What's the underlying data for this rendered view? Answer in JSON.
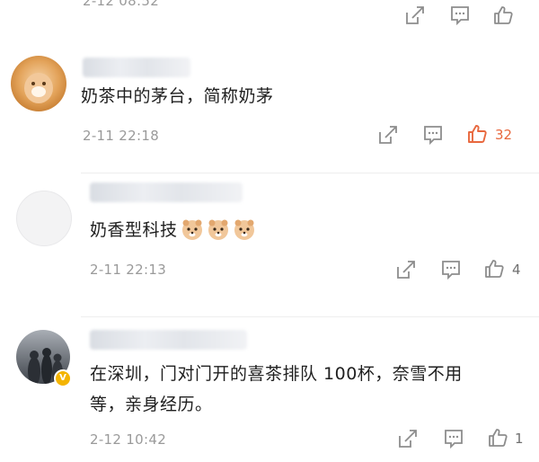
{
  "top_partial": {
    "date": "2-12 08:52"
  },
  "comments": [
    {
      "text": "奶茶中的茅台，简称奶茅",
      "date": "2-11 22:18",
      "likes": "32",
      "liked": true,
      "colors": {
        "like": "#e8683e"
      }
    },
    {
      "text": "奶香型科技",
      "emoji_icons": [
        "doge-face-icon",
        "doge-face-icon",
        "doge-face-icon"
      ],
      "date": "2-11 22:13",
      "likes": "4",
      "liked": false
    },
    {
      "text_line1": "在深圳，门对门开的喜茶排队 100杯，奈雪不用",
      "text_line2": "等，亲身经历。",
      "date": "2-12 10:42",
      "likes": "1",
      "liked": false,
      "verified": true
    }
  ],
  "icons": {
    "repost": "share-edit-icon",
    "comment": "comment-bubble-icon",
    "like": "thumbs-up-icon"
  }
}
